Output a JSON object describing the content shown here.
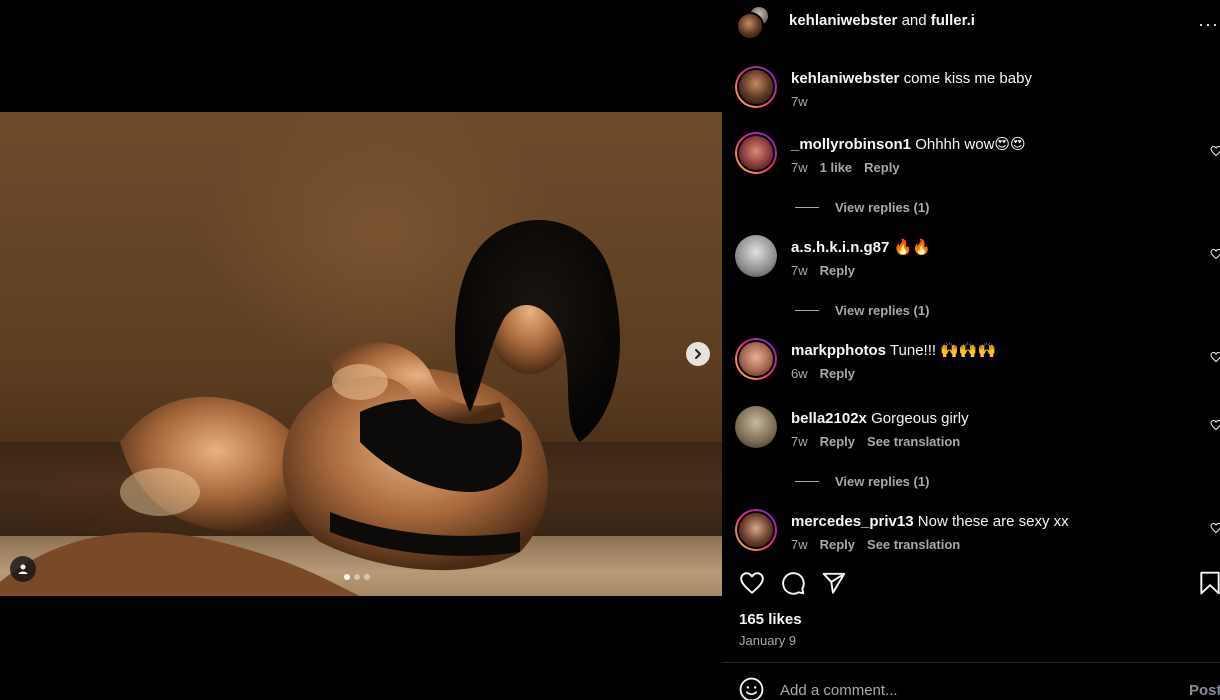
{
  "media": {
    "carousel": {
      "total": 3,
      "active_index": 0
    }
  },
  "header": {
    "user1": "kehlaniwebster",
    "connector": "and",
    "user2": "fuller.i",
    "more_label": "···"
  },
  "comments": [
    {
      "user": "kehlaniwebster",
      "text": "come kiss me baby",
      "time": "7w",
      "likes": "",
      "reply": "",
      "translate": "",
      "view_replies": ""
    },
    {
      "user": "_mollyrobinson1",
      "text": "Ohhhh wow😍😍",
      "time": "7w",
      "likes": "1 like",
      "reply": "Reply",
      "translate": "",
      "view_replies": "View replies (1)"
    },
    {
      "user": "a.s.h.k.i.n.g87",
      "text": "🔥🔥",
      "time": "7w",
      "likes": "",
      "reply": "Reply",
      "translate": "",
      "view_replies": "View replies (1)"
    },
    {
      "user": "markpphotos",
      "text": "Tune!!! 🙌🙌🙌",
      "time": "6w",
      "likes": "",
      "reply": "Reply",
      "translate": "",
      "view_replies": ""
    },
    {
      "user": "bella2102x",
      "text": "Gorgeous girly",
      "time": "7w",
      "likes": "",
      "reply": "Reply",
      "translate": "See translation",
      "view_replies": "View replies (1)"
    },
    {
      "user": "mercedes_priv13",
      "text": "Now these are sexy xx",
      "time": "7w",
      "likes": "",
      "reply": "Reply",
      "translate": "See translation",
      "view_replies": ""
    }
  ],
  "stats": {
    "likes": "165 likes",
    "date": "January 9"
  },
  "composer": {
    "placeholder": "Add a comment...",
    "post_label": "Post"
  },
  "colors": {
    "background": "#000000",
    "text": "#f5f5f5",
    "muted": "#a8a8a8",
    "post_disabled": "#85899a",
    "story_ring_start": "#f9ce34",
    "story_ring_mid": "#ee2a7b",
    "story_ring_end": "#6228d7"
  },
  "icons": {
    "next": "chevron-right-icon",
    "tag": "user-icon",
    "like": "heart-icon",
    "comment": "comment-bubble-icon",
    "share": "paper-plane-icon",
    "save": "bookmark-icon",
    "emoji": "smiley-icon",
    "more": "ellipsis-icon"
  }
}
